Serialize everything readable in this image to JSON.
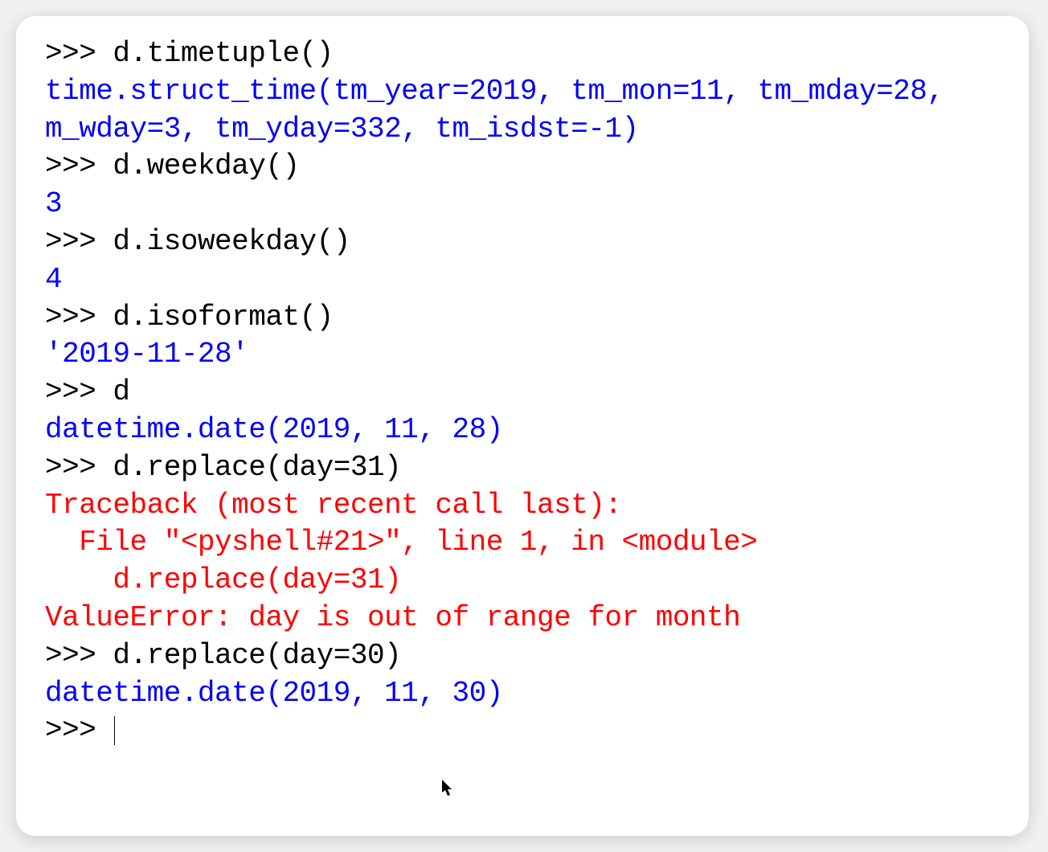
{
  "prompt": ">>> ",
  "lines": [
    {
      "type": "input",
      "text": "d.timetuple()"
    },
    {
      "type": "output_blue",
      "text": "time.struct_time(tm_year=2019, tm_mon=11, tm_mday=28,"
    },
    {
      "type": "output_blue_cont",
      "text": "m_wday=3, tm_yday=332, tm_isdst=-1)"
    },
    {
      "type": "input",
      "text": "d.weekday()"
    },
    {
      "type": "output_blue",
      "text": "3"
    },
    {
      "type": "input",
      "text": "d.isoweekday()"
    },
    {
      "type": "output_blue",
      "text": "4"
    },
    {
      "type": "input",
      "text": "d.isoformat()"
    },
    {
      "type": "output_blue",
      "text": "'2019-11-28'"
    },
    {
      "type": "input",
      "text": "d"
    },
    {
      "type": "output_blue",
      "text": "datetime.date(2019, 11, 28)"
    },
    {
      "type": "input",
      "text": "d.replace(day=31)"
    },
    {
      "type": "output_red",
      "text": "Traceback (most recent call last):"
    },
    {
      "type": "output_red",
      "text": "  File \"<pyshell#21>\", line 1, in <module>"
    },
    {
      "type": "output_red",
      "text": "    d.replace(day=31)"
    },
    {
      "type": "output_red",
      "text": "ValueError: day is out of range for month"
    },
    {
      "type": "input",
      "text": "d.replace(day=30)"
    },
    {
      "type": "output_blue",
      "text": "datetime.date(2019, 11, 30)"
    },
    {
      "type": "prompt_only",
      "text": ""
    }
  ],
  "colors": {
    "prompt": "#000000",
    "input": "#000000",
    "output_blue": "#0000ff",
    "output_red": "#ff0000"
  }
}
